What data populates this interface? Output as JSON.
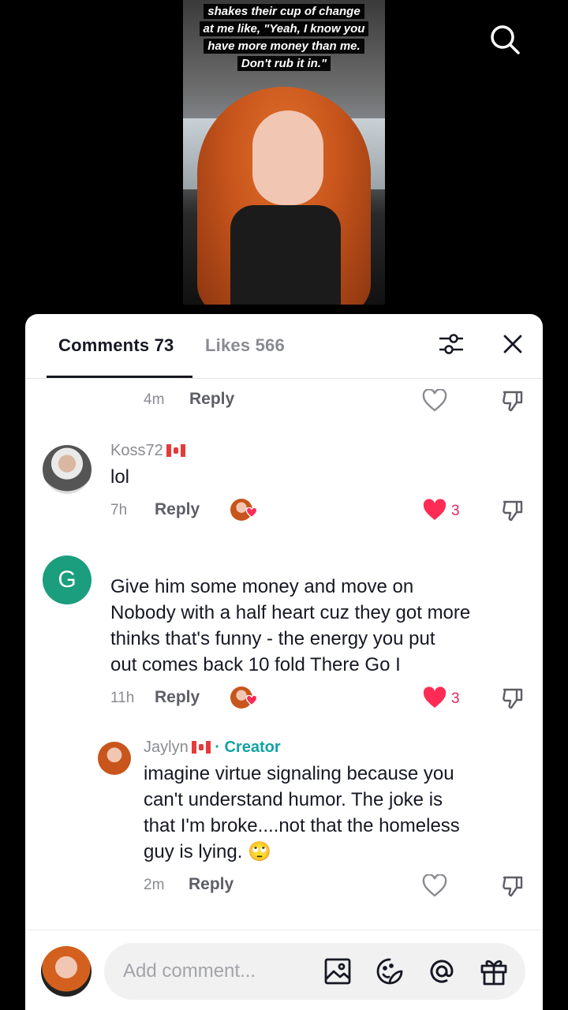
{
  "video": {
    "caption_lines": [
      "shakes their cup of change",
      "at me like, \"Yeah, I know you",
      "have more money than me.",
      "Don't rub it in.\""
    ]
  },
  "tabs": {
    "comments_label": "Comments 73",
    "likes_label": "Likes 566"
  },
  "comments": [
    {
      "time": "4m",
      "reply_label": "Reply",
      "liked": false
    },
    {
      "username": "Koss72",
      "flag": "Canada",
      "text": "lol",
      "time": "7h",
      "reply_label": "Reply",
      "like_count": "3",
      "liked": true
    },
    {
      "avatar_letter": "G",
      "avatar_color": "#1a9e7e",
      "text_lines": [
        "Give him some money and move on",
        "Nobody with a half heart cuz they got more",
        "thinks that's funny - the energy you put",
        "out comes back 10 fold There Go I"
      ],
      "time": "11h",
      "reply_label": "Reply",
      "like_count": "3",
      "liked": true
    },
    {
      "username": "Jaylyn",
      "flag": "Canada",
      "creator_label": "· Creator",
      "text_lines": [
        "imagine virtue signaling because you",
        "can't understand humor. The joke is",
        "that I'm broke....not that the homeless",
        "guy is lying. 🙄"
      ],
      "time": "2m",
      "reply_label": "Reply",
      "liked": false
    }
  ],
  "composer": {
    "placeholder": "Add comment..."
  },
  "colors": {
    "accent_like": "#fe2c55",
    "creator": "#11a3a3",
    "avatar_g": "#1a9e7e"
  },
  "icons": [
    "search-icon",
    "filter-icon",
    "close-icon",
    "heart-icon",
    "dislike-icon",
    "image-icon",
    "emoji-icon",
    "mention-icon",
    "gift-icon"
  ]
}
